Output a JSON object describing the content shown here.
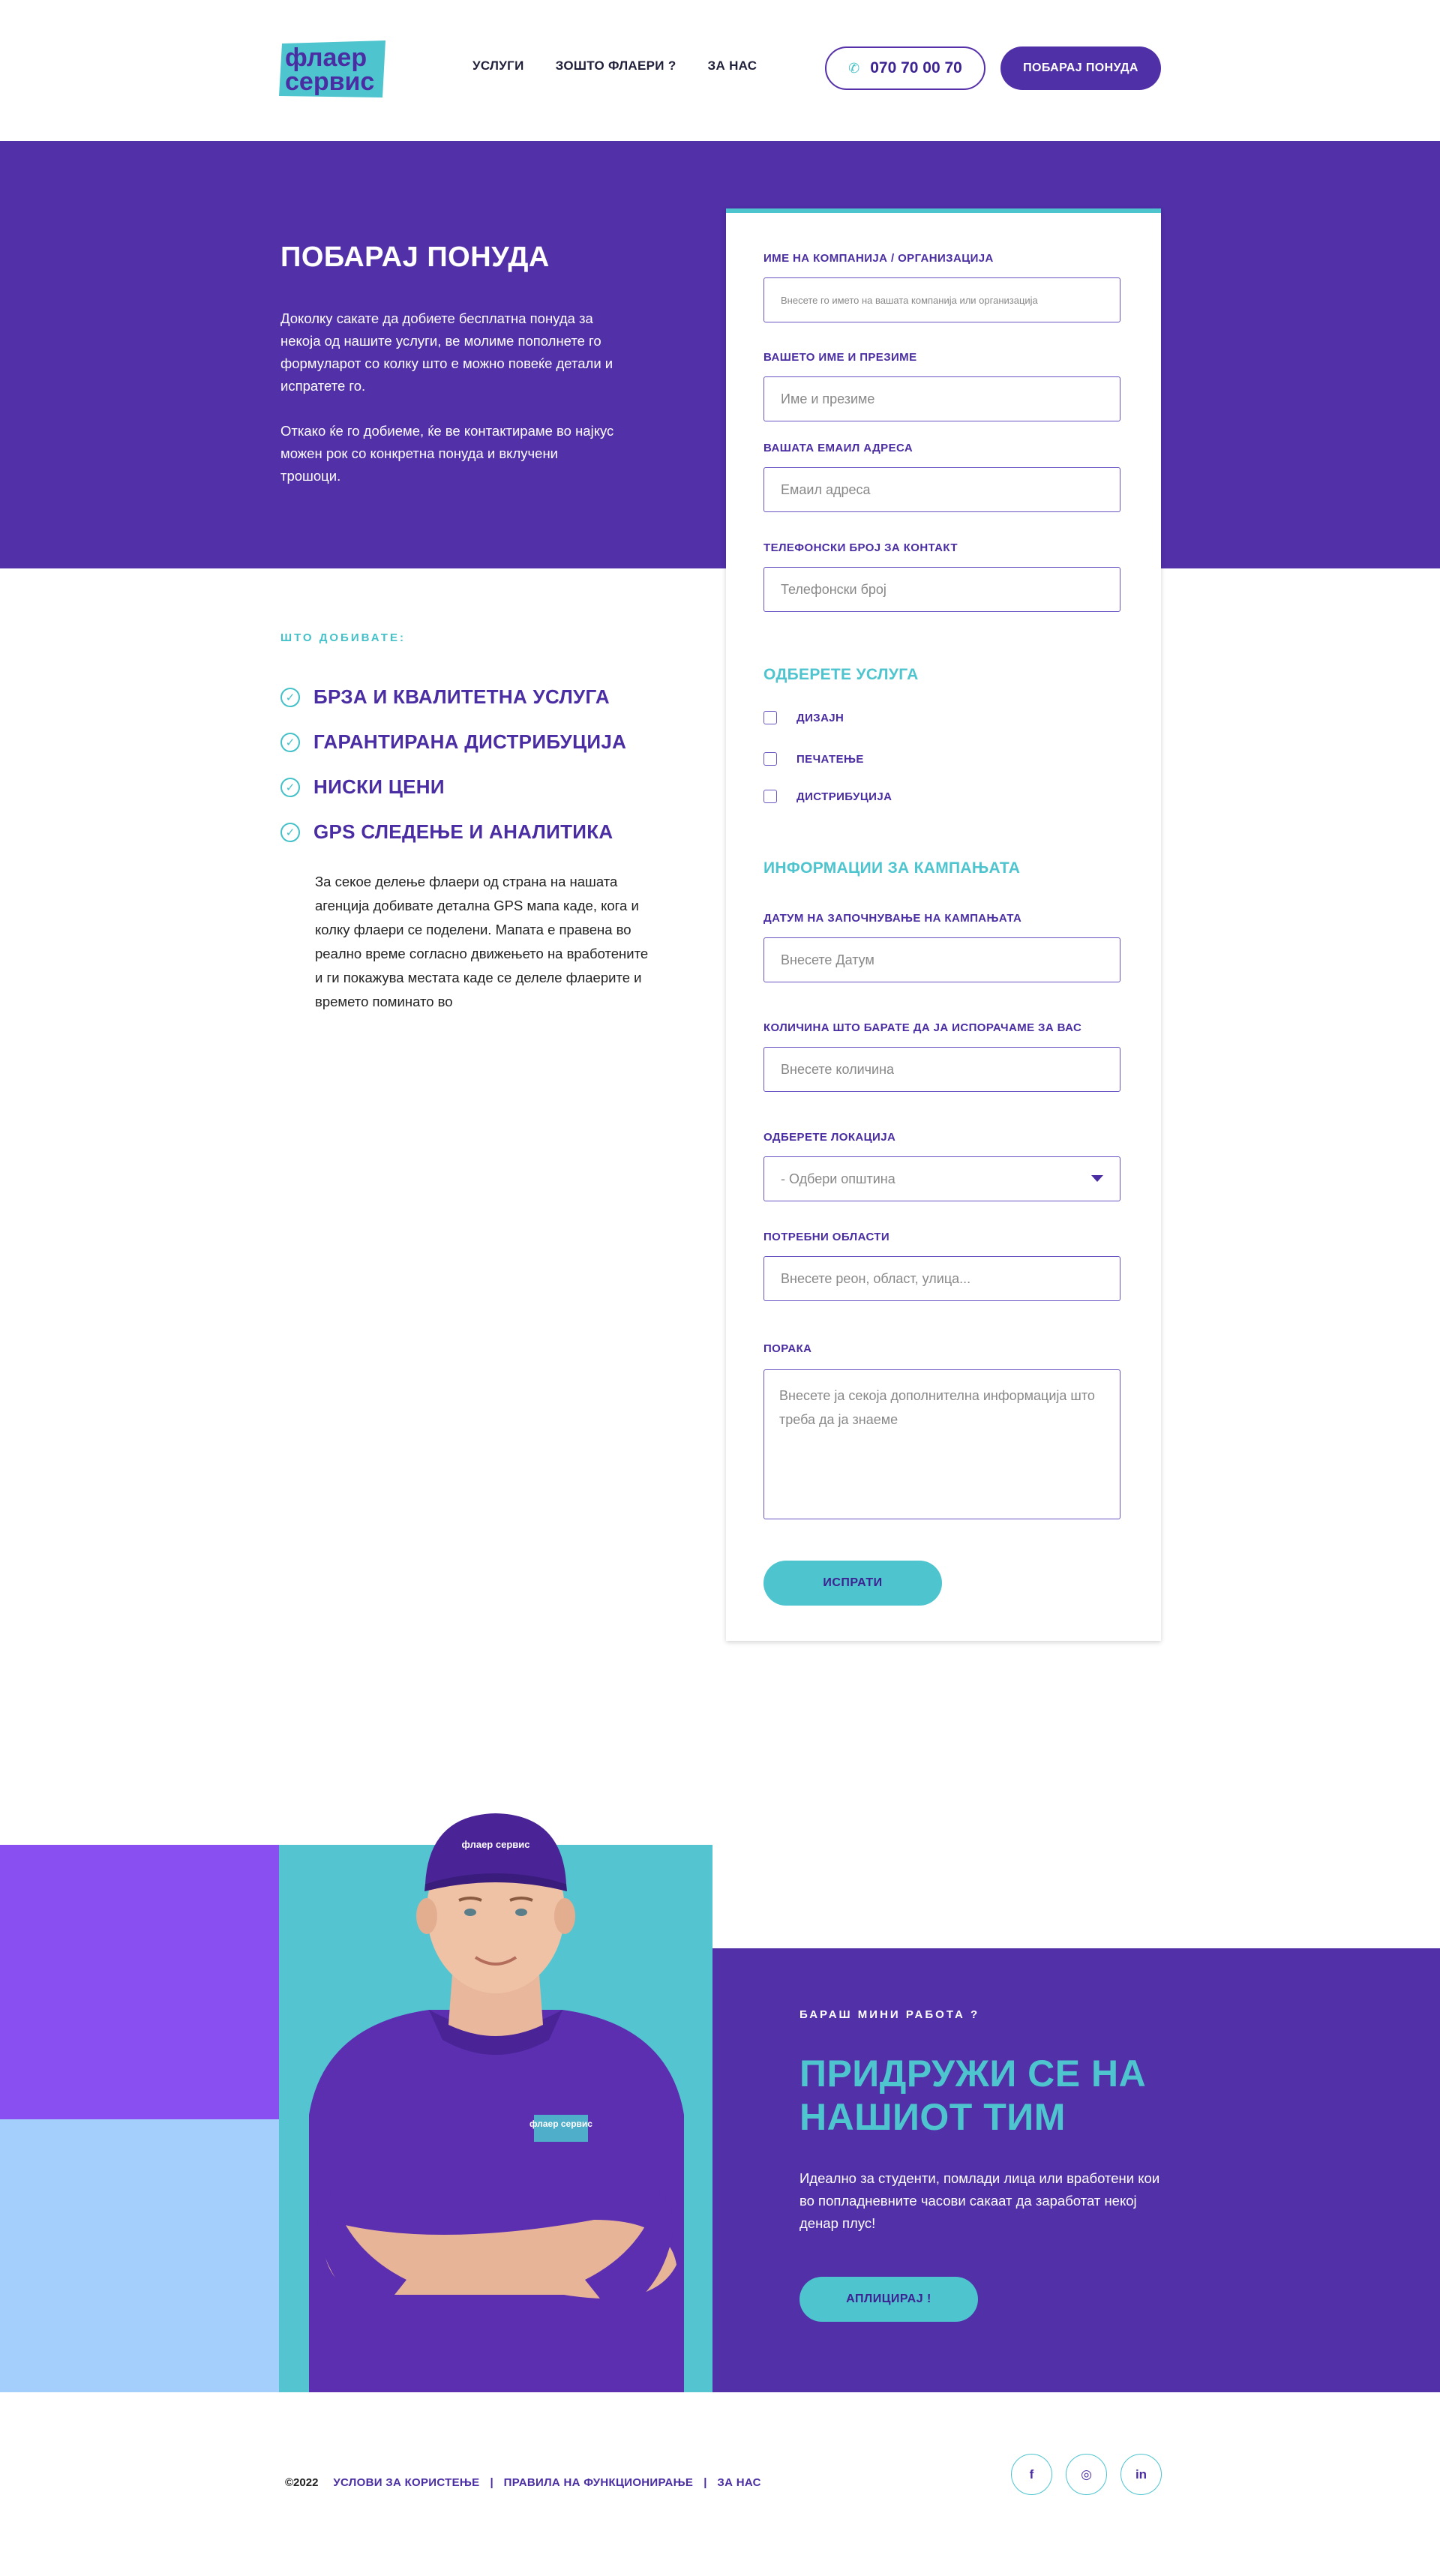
{
  "header": {
    "logo_text": "флаер сервис",
    "nav": [
      "УСЛУГИ",
      "ЗОШТО ФЛАЕРИ ?",
      "ЗА НАС"
    ],
    "phone": "070 70 00 70",
    "cta": "ПОБАРАЈ ПОНУДА",
    "phone_icon": "phone-icon"
  },
  "hero": {
    "title": "ПОБАРАЈ ПОНУДА",
    "p1": "Доколку сакате да добиете бесплатна понуда за некоја од нашите услуги, ве молиме пополнете го формуларот со колку што е можно повеќе детали и испратете го.",
    "p2": "Откако ќе го добиеме, ќе ве контактираме во најкус можен рок со конкретна понуда и вклучени трошоци."
  },
  "benefits": {
    "label": "ШТО ДОБИВАТЕ:",
    "items": [
      "БРЗА И КВАЛИТЕТНА УСЛУГА",
      "ГАРАНТИРАНА ДИСТРИБУЦИЈА",
      "НИСКИ ЦЕНИ",
      "GPS СЛЕДЕЊЕ И АНАЛИТИКА"
    ],
    "description": "За секое делење флаери од страна на нашата агенција добивате детална GPS мапа каде, кога и колку флаери се поделени. Мапата е правена во реално време согласно движењето на вработените и ги покажува местата каде се делеле флаерите и времето поминато во",
    "check_icon": "check-circle-icon"
  },
  "form": {
    "company_label": "ИМЕ НА КОМПАНИЈА / ОРГАНИЗАЦИЈА",
    "company_placeholder": "Внесете го името на вашата компанија или организација",
    "name_label": "ВАШЕТО ИМЕ И ПРЕЗИМЕ",
    "name_placeholder": "Име и презиме",
    "email_label": "ВАШАТА ЕМАИЛ АДРЕСА",
    "email_placeholder": "Емаил адреса",
    "phone_label": "ТЕЛЕФОНСКИ БРОЈ ЗА КОНТАКТ",
    "phone_placeholder": "Телефонски број",
    "services_heading": "ОДБЕРЕТЕ УСЛУГА",
    "services": [
      "ДИЗАЈН",
      "ПЕЧАТЕЊЕ",
      "ДИСТРИБУЦИЈА"
    ],
    "campaign_heading": "ИНФОРМАЦИИ ЗА КАМПАЊАТА",
    "date_label": "ДАТУМ НА ЗАПОЧНУВАЊЕ НА КАМПАЊАТА",
    "date_placeholder": "Внесете Датум",
    "qty_label": "КОЛИЧИНА ШТО БАРАТЕ ДА ЈА ИСПОРАЧАМЕ ЗА ВАС",
    "qty_placeholder": "Внесете количина",
    "location_label": "ОДБЕРЕТЕ ЛОКАЦИЈА",
    "location_value": "- Одбери општина",
    "areas_label": "ПОТРЕБНИ ОБЛАСТИ",
    "areas_placeholder": "Внесете реон, област, улица...",
    "message_label": "ПОРАКА",
    "message_placeholder": "Внесете ја секоја дополнителна информација што треба да ја знаеме",
    "submit": "ИСПРАТИ"
  },
  "join": {
    "label": "БАРАШ МИНИ РАБОТА ?",
    "title": "ПРИДРУЖИ СЕ НА НАШИОТ ТИМ",
    "text": "Идеално за студенти, помлади лица или вработени кои во попладневните часови сакаат да заработат некој денар плус!",
    "button": "АПЛИЦИРАЈ !",
    "cap_logo": "флаер сервис",
    "shirt_logo": "флаер сервис"
  },
  "footer": {
    "copyright": "©2022",
    "links": [
      "УСЛОВИ ЗА КОРИСТЕЊЕ",
      "ПРАВИЛА НА ФУНКЦИОНИРАЊЕ",
      "ЗА НАС"
    ],
    "socials": [
      {
        "icon": "facebook-icon",
        "glyph": "f"
      },
      {
        "icon": "instagram-icon",
        "glyph": "◎"
      },
      {
        "icon": "linkedin-icon",
        "glyph": "in"
      }
    ]
  },
  "colors": {
    "brand_purple": "#5130a8",
    "brand_teal": "#4ec4cf",
    "accent_violet": "#8a4ff0",
    "light_blue": "#a4cefc"
  }
}
